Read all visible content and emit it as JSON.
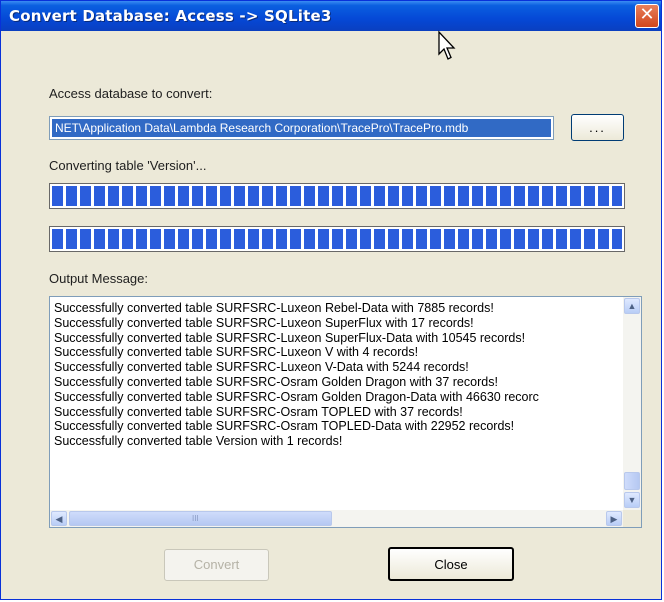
{
  "window": {
    "title": "Convert Database: Access -> SQLite3",
    "close_glyph": "✕"
  },
  "source": {
    "label": "Access database to convert:",
    "path_value": "NET\\Application Data\\Lambda Research Corporation\\TracePro\\TracePro.mdb",
    "browse_label": "..."
  },
  "status": {
    "text": "Converting table 'Version'...",
    "progress_table_fraction": 1.0,
    "progress_overall_fraction": 1.0
  },
  "output": {
    "label": "Output Message:",
    "lines": [
      "Successfully converted table SURFSRC-Luxeon Rebel-Data with 7885 records!",
      "Successfully converted table SURFSRC-Luxeon SuperFlux with 17 records!",
      "Successfully converted table SURFSRC-Luxeon SuperFlux-Data with 10545 records!",
      "Successfully converted table SURFSRC-Luxeon V with 4 records!",
      "Successfully converted table SURFSRC-Luxeon V-Data with 5244 records!",
      "Successfully converted table SURFSRC-Osram Golden Dragon with 37 records!",
      "Successfully converted table SURFSRC-Osram Golden Dragon-Data with 46630 recorc",
      "Successfully converted table SURFSRC-Osram TOPLED with 37 records!",
      "Successfully converted table SURFSRC-Osram TOPLED-Data with 22952 records!",
      "Successfully converted table Version with 1 records!"
    ],
    "scroll_up": "▲",
    "scroll_down": "▼",
    "scroll_left": "◀",
    "scroll_right": "▶",
    "thumb_grip": "III"
  },
  "buttons": {
    "convert_label": "Convert",
    "close_label": "Close"
  },
  "colors": {
    "title_bar": "#0548d6",
    "progress_fill": "#2b5ddc",
    "selection": "#316ac5",
    "dialog_bg": "#ece9d8"
  },
  "icons": {
    "cursor": "arrow-cursor-icon"
  }
}
